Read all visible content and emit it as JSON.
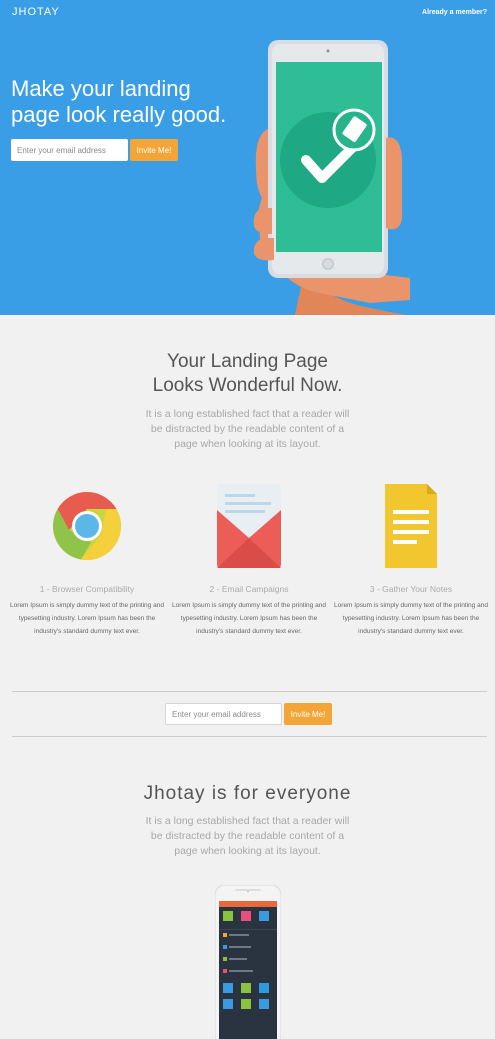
{
  "brand": "JHOTAY",
  "header": {
    "member_link": "Already a member?"
  },
  "hero": {
    "headline": "Make your landing page look really good.",
    "email_placeholder": "Enter your email address",
    "invite_label": "Invite Me!"
  },
  "features": {
    "title_line1": "Your Landing Page",
    "title_line2": "Looks Wonderful Now.",
    "lead": "It is a long established fact that a reader will be distracted by the readable content of a page when looking at its layout.",
    "items": [
      {
        "icon": "chrome-icon",
        "title": "1 - Browser Compatibility",
        "text": "Lorem Ipsum is simply dummy text of the printing and typesetting industry. Lorem Ipsum has been the industry's standard dummy text ever."
      },
      {
        "icon": "email-icon",
        "title": "2 - Email Campaigns",
        "text": "Lorem Ipsum is simply dummy text of the printing and typesetting industry. Lorem Ipsum has been the industry's standard dummy text ever."
      },
      {
        "icon": "notes-icon",
        "title": "3 - Gather Your Notes",
        "text": "Lorem Ipsum is simply dummy text of the printing and typesetting industry. Lorem Ipsum has been the industry's standard dummy text ever."
      }
    ]
  },
  "signup": {
    "email_placeholder": "Enter your email address",
    "invite_label": "Invite Me!"
  },
  "everyone": {
    "title": "Jhotay is for everyone",
    "lead": "It is a long established fact that a reader will be distracted by the readable content of a page when looking at its layout."
  },
  "colors": {
    "hero_bg": "#3a9ee6",
    "accent_orange": "#f3a537",
    "screen_green": "#2ebd95"
  }
}
